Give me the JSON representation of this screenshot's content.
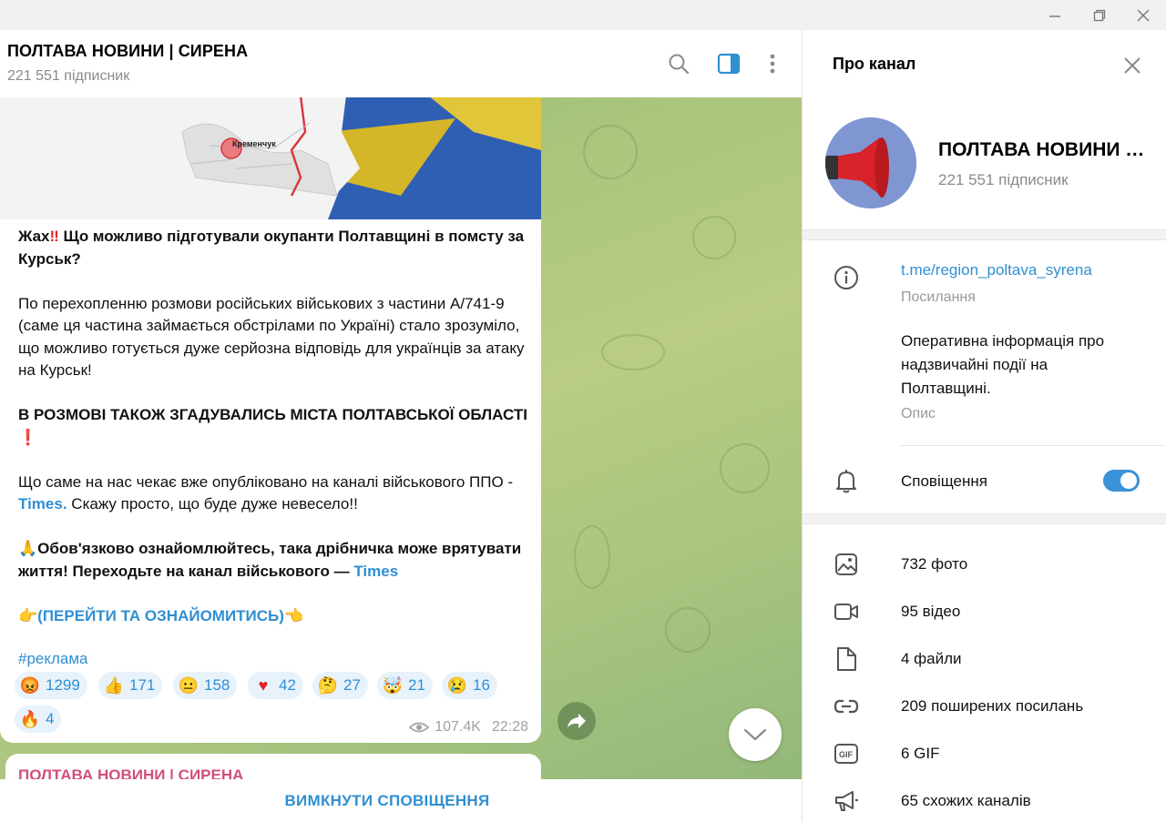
{
  "chat": {
    "title": "ПОЛТАВА НОВИНИ | СИРЕНА",
    "subscribers": "221 551 підписник"
  },
  "message": {
    "map_label": "Кременчук",
    "headline_a": "Жах",
    "headline_b": " Що можливо підготували окупанти Полтавщині в помсту за Курськ?",
    "p1": "По перехопленню розмови російських військових з частини А/741-9 (саме ця частина займається обстрілами по Україні) стало зрозуміло, що можливо готується дуже серйозна відповідь для українців за атаку на Курськ!",
    "p2": "В РОЗМОВІ ТАКОЖ ЗГАДУВАЛИСЬ МІСТА  ПОЛТАВСЬКОЇ ОБЛАСТІ",
    "p3_a": "Що саме на нас чекає вже опубліковано на каналі військового ППО - ",
    "p3_link": "Times.",
    "p3_b": " Скажу просто, що буде дуже невесело!!",
    "p4_a": "Обов'язково ознайомлюйтесь, така дрібничка може врятувати життя! Переходьте на канал військового —  ",
    "p4_link": "Times",
    "cta": "(ПЕРЕЙТИ ТА ОЗНАЙОМИТИСЬ)",
    "hashtag": "#реклама",
    "reactions": [
      {
        "icon": "angry-face-icon",
        "count": "1299"
      },
      {
        "icon": "thumbs-up-icon",
        "count": "171"
      },
      {
        "icon": "neutral-face-icon",
        "count": "158"
      },
      {
        "icon": "heart-icon",
        "count": "42"
      },
      {
        "icon": "thinking-face-icon",
        "count": "27"
      },
      {
        "icon": "exploding-head-icon",
        "count": "21"
      },
      {
        "icon": "crying-face-icon",
        "count": "16"
      },
      {
        "icon": "fire-icon",
        "count": "4"
      }
    ],
    "views": "107.4K",
    "time": "22:28"
  },
  "next_message": {
    "sender": "ПОЛТАВА НОВИНИ | СИРЕНА"
  },
  "bottom_bar": {
    "label": "ВИМКНУТИ СПОВІЩЕННЯ"
  },
  "panel": {
    "title": "Про канал",
    "name": "ПОЛТАВА НОВИНИ | СИРЕНА",
    "subscribers": "221 551 підписник",
    "link": "t.me/region_poltava_syrena",
    "link_label": "Посилання",
    "description": "Оперативна інформація про надзвичайні події на Полтавщині.",
    "description_label": "Опис",
    "notifications_label": "Сповіщення",
    "notifications_on": true,
    "media": [
      {
        "icon": "photo-icon",
        "label": "732 фото"
      },
      {
        "icon": "video-icon",
        "label": "95 відео"
      },
      {
        "icon": "file-icon",
        "label": "4 файли"
      },
      {
        "icon": "link-icon",
        "label": "209 поширених посилань"
      },
      {
        "icon": "gif-icon",
        "label": "6 GIF"
      },
      {
        "icon": "megaphone-icon",
        "label": "65 схожих каналів"
      }
    ]
  },
  "colors": {
    "accent": "#2f8fd2",
    "toggle": "#3a92d9",
    "sender": "#d14f7b"
  }
}
